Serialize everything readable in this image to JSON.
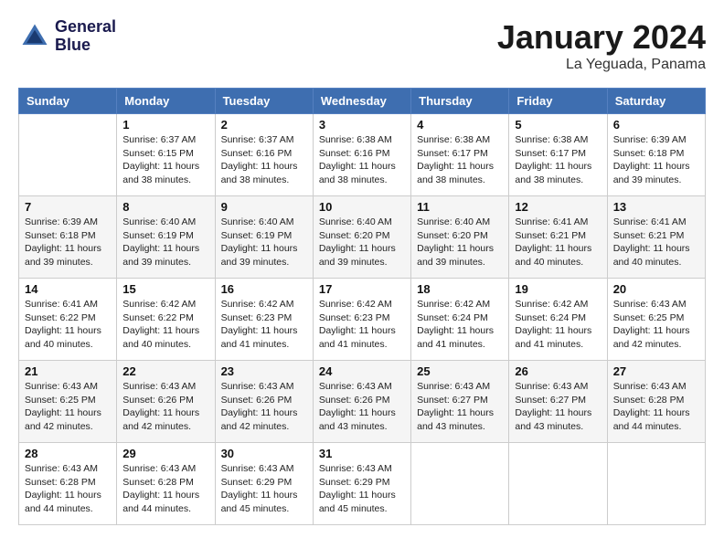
{
  "header": {
    "logo_line1": "General",
    "logo_line2": "Blue",
    "month": "January 2024",
    "location": "La Yeguada, Panama"
  },
  "days_of_week": [
    "Sunday",
    "Monday",
    "Tuesday",
    "Wednesday",
    "Thursday",
    "Friday",
    "Saturday"
  ],
  "weeks": [
    [
      {
        "day": "",
        "sunrise": "",
        "sunset": "",
        "daylight": ""
      },
      {
        "day": "1",
        "sunrise": "Sunrise: 6:37 AM",
        "sunset": "Sunset: 6:15 PM",
        "daylight": "Daylight: 11 hours and 38 minutes."
      },
      {
        "day": "2",
        "sunrise": "Sunrise: 6:37 AM",
        "sunset": "Sunset: 6:16 PM",
        "daylight": "Daylight: 11 hours and 38 minutes."
      },
      {
        "day": "3",
        "sunrise": "Sunrise: 6:38 AM",
        "sunset": "Sunset: 6:16 PM",
        "daylight": "Daylight: 11 hours and 38 minutes."
      },
      {
        "day": "4",
        "sunrise": "Sunrise: 6:38 AM",
        "sunset": "Sunset: 6:17 PM",
        "daylight": "Daylight: 11 hours and 38 minutes."
      },
      {
        "day": "5",
        "sunrise": "Sunrise: 6:38 AM",
        "sunset": "Sunset: 6:17 PM",
        "daylight": "Daylight: 11 hours and 38 minutes."
      },
      {
        "day": "6",
        "sunrise": "Sunrise: 6:39 AM",
        "sunset": "Sunset: 6:18 PM",
        "daylight": "Daylight: 11 hours and 39 minutes."
      }
    ],
    [
      {
        "day": "7",
        "sunrise": "Sunrise: 6:39 AM",
        "sunset": "Sunset: 6:18 PM",
        "daylight": "Daylight: 11 hours and 39 minutes."
      },
      {
        "day": "8",
        "sunrise": "Sunrise: 6:40 AM",
        "sunset": "Sunset: 6:19 PM",
        "daylight": "Daylight: 11 hours and 39 minutes."
      },
      {
        "day": "9",
        "sunrise": "Sunrise: 6:40 AM",
        "sunset": "Sunset: 6:19 PM",
        "daylight": "Daylight: 11 hours and 39 minutes."
      },
      {
        "day": "10",
        "sunrise": "Sunrise: 6:40 AM",
        "sunset": "Sunset: 6:20 PM",
        "daylight": "Daylight: 11 hours and 39 minutes."
      },
      {
        "day": "11",
        "sunrise": "Sunrise: 6:40 AM",
        "sunset": "Sunset: 6:20 PM",
        "daylight": "Daylight: 11 hours and 39 minutes."
      },
      {
        "day": "12",
        "sunrise": "Sunrise: 6:41 AM",
        "sunset": "Sunset: 6:21 PM",
        "daylight": "Daylight: 11 hours and 40 minutes."
      },
      {
        "day": "13",
        "sunrise": "Sunrise: 6:41 AM",
        "sunset": "Sunset: 6:21 PM",
        "daylight": "Daylight: 11 hours and 40 minutes."
      }
    ],
    [
      {
        "day": "14",
        "sunrise": "Sunrise: 6:41 AM",
        "sunset": "Sunset: 6:22 PM",
        "daylight": "Daylight: 11 hours and 40 minutes."
      },
      {
        "day": "15",
        "sunrise": "Sunrise: 6:42 AM",
        "sunset": "Sunset: 6:22 PM",
        "daylight": "Daylight: 11 hours and 40 minutes."
      },
      {
        "day": "16",
        "sunrise": "Sunrise: 6:42 AM",
        "sunset": "Sunset: 6:23 PM",
        "daylight": "Daylight: 11 hours and 41 minutes."
      },
      {
        "day": "17",
        "sunrise": "Sunrise: 6:42 AM",
        "sunset": "Sunset: 6:23 PM",
        "daylight": "Daylight: 11 hours and 41 minutes."
      },
      {
        "day": "18",
        "sunrise": "Sunrise: 6:42 AM",
        "sunset": "Sunset: 6:24 PM",
        "daylight": "Daylight: 11 hours and 41 minutes."
      },
      {
        "day": "19",
        "sunrise": "Sunrise: 6:42 AM",
        "sunset": "Sunset: 6:24 PM",
        "daylight": "Daylight: 11 hours and 41 minutes."
      },
      {
        "day": "20",
        "sunrise": "Sunrise: 6:43 AM",
        "sunset": "Sunset: 6:25 PM",
        "daylight": "Daylight: 11 hours and 42 minutes."
      }
    ],
    [
      {
        "day": "21",
        "sunrise": "Sunrise: 6:43 AM",
        "sunset": "Sunset: 6:25 PM",
        "daylight": "Daylight: 11 hours and 42 minutes."
      },
      {
        "day": "22",
        "sunrise": "Sunrise: 6:43 AM",
        "sunset": "Sunset: 6:26 PM",
        "daylight": "Daylight: 11 hours and 42 minutes."
      },
      {
        "day": "23",
        "sunrise": "Sunrise: 6:43 AM",
        "sunset": "Sunset: 6:26 PM",
        "daylight": "Daylight: 11 hours and 42 minutes."
      },
      {
        "day": "24",
        "sunrise": "Sunrise: 6:43 AM",
        "sunset": "Sunset: 6:26 PM",
        "daylight": "Daylight: 11 hours and 43 minutes."
      },
      {
        "day": "25",
        "sunrise": "Sunrise: 6:43 AM",
        "sunset": "Sunset: 6:27 PM",
        "daylight": "Daylight: 11 hours and 43 minutes."
      },
      {
        "day": "26",
        "sunrise": "Sunrise: 6:43 AM",
        "sunset": "Sunset: 6:27 PM",
        "daylight": "Daylight: 11 hours and 43 minutes."
      },
      {
        "day": "27",
        "sunrise": "Sunrise: 6:43 AM",
        "sunset": "Sunset: 6:28 PM",
        "daylight": "Daylight: 11 hours and 44 minutes."
      }
    ],
    [
      {
        "day": "28",
        "sunrise": "Sunrise: 6:43 AM",
        "sunset": "Sunset: 6:28 PM",
        "daylight": "Daylight: 11 hours and 44 minutes."
      },
      {
        "day": "29",
        "sunrise": "Sunrise: 6:43 AM",
        "sunset": "Sunset: 6:28 PM",
        "daylight": "Daylight: 11 hours and 44 minutes."
      },
      {
        "day": "30",
        "sunrise": "Sunrise: 6:43 AM",
        "sunset": "Sunset: 6:29 PM",
        "daylight": "Daylight: 11 hours and 45 minutes."
      },
      {
        "day": "31",
        "sunrise": "Sunrise: 6:43 AM",
        "sunset": "Sunset: 6:29 PM",
        "daylight": "Daylight: 11 hours and 45 minutes."
      },
      {
        "day": "",
        "sunrise": "",
        "sunset": "",
        "daylight": ""
      },
      {
        "day": "",
        "sunrise": "",
        "sunset": "",
        "daylight": ""
      },
      {
        "day": "",
        "sunrise": "",
        "sunset": "",
        "daylight": ""
      }
    ]
  ]
}
